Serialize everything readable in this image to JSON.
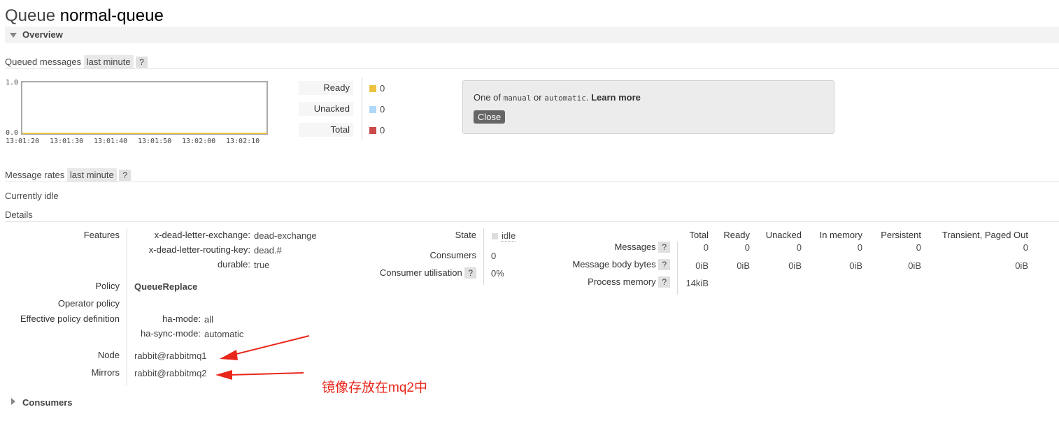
{
  "header": {
    "title_prefix": "Queue",
    "queue_name": "normal-queue"
  },
  "overview": {
    "label": "Overview"
  },
  "queued_messages": {
    "label": "Queued messages",
    "range": "last minute",
    "help": "?",
    "chart_data": {
      "type": "line",
      "x": [
        "13:01:20",
        "13:01:30",
        "13:01:40",
        "13:01:50",
        "13:02:00",
        "13:02:10"
      ],
      "series": [
        {
          "name": "Ready",
          "values": [
            0,
            0,
            0,
            0,
            0,
            0
          ]
        },
        {
          "name": "Unacked",
          "values": [
            0,
            0,
            0,
            0,
            0,
            0
          ]
        },
        {
          "name": "Total",
          "values": [
            0,
            0,
            0,
            0,
            0,
            0
          ]
        }
      ],
      "ylim": [
        0.0,
        1.0
      ],
      "y_ticks": [
        "1.0",
        "0.0"
      ]
    },
    "legend": [
      {
        "label": "Ready",
        "value": "0",
        "color": "#edc240"
      },
      {
        "label": "Unacked",
        "value": "0",
        "color": "#afd8f8"
      },
      {
        "label": "Total",
        "value": "0",
        "color": "#cb4b4b"
      }
    ]
  },
  "help_popup": {
    "text_pre": "One of",
    "code1": "manual",
    "text_or": "or",
    "code2": "automatic",
    "text_dot": ".",
    "link": "Learn more",
    "close": "Close"
  },
  "message_rates": {
    "label": "Message rates",
    "range": "last minute",
    "help": "?"
  },
  "status": {
    "idle_text": "Currently idle"
  },
  "details": {
    "label": "Details",
    "features_label": "Features",
    "features": [
      {
        "key": "x-dead-letter-exchange:",
        "value": "dead-exchange"
      },
      {
        "key": "x-dead-letter-routing-key:",
        "value": "dead.#"
      },
      {
        "key": "durable:",
        "value": "true"
      }
    ],
    "policy_label": "Policy",
    "policy_value": "QueueReplace",
    "operator_policy_label": "Operator policy",
    "effective_label": "Effective policy definition",
    "effective": [
      {
        "key": "ha-mode:",
        "value": "all"
      },
      {
        "key": "ha-sync-mode:",
        "value": "automatic"
      }
    ],
    "node_label": "Node",
    "node_value": "rabbit@rabbitmq1",
    "mirrors_label": "Mirrors",
    "mirrors_value": "rabbit@rabbitmq2",
    "state_label": "State",
    "state_value": "idle",
    "consumers_label": "Consumers",
    "consumers_value": "0",
    "consumer_util_label": "Consumer utilisation",
    "consumer_util_value": "0%",
    "stats_headers": [
      "Total",
      "Ready",
      "Unacked",
      "In memory",
      "Persistent",
      "Transient, Paged Out"
    ],
    "messages_label": "Messages",
    "messages_values": [
      "0",
      "0",
      "0",
      "0",
      "0",
      "0"
    ],
    "body_bytes_label": "Message body bytes",
    "body_bytes_values": [
      "0iB",
      "0iB",
      "0iB",
      "0iB",
      "0iB",
      "0iB"
    ],
    "process_memory_label": "Process memory",
    "process_memory_value": "14kiB",
    "help": "?"
  },
  "annotation": {
    "text": "镜像存放在mq2中",
    "color": "#e8261a"
  },
  "consumers_section": {
    "label": "Consumers"
  }
}
